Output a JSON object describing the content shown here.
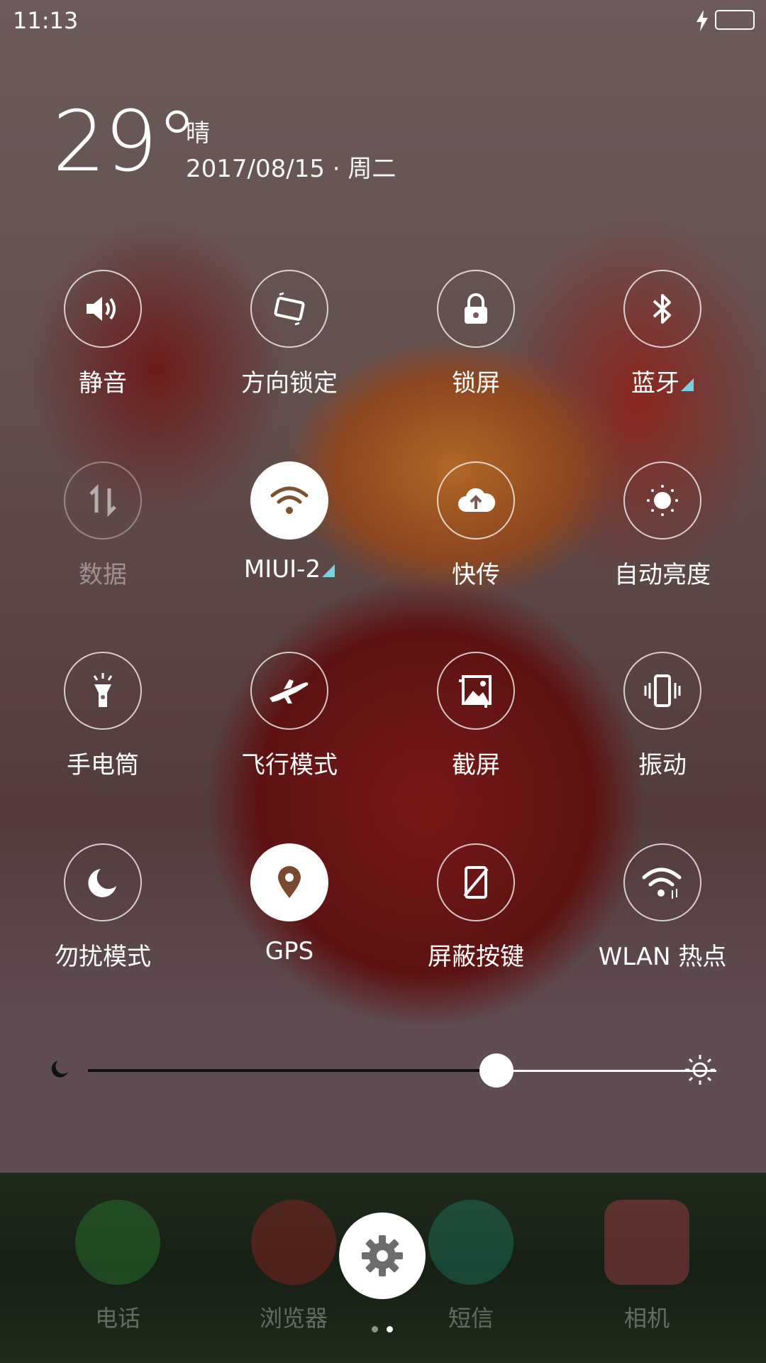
{
  "status_bar": {
    "time": "11:13",
    "battery_color": "#3ed64a",
    "icons": [
      "charging-bolt-icon",
      "battery-icon"
    ]
  },
  "weather": {
    "temperature": "29°",
    "condition": "晴",
    "date": "2017/08/15 · 周二"
  },
  "toggles": [
    {
      "label": "静音",
      "icon": "speaker-icon",
      "state": "normal"
    },
    {
      "label": "方向锁定",
      "icon": "rotation-lock-icon",
      "state": "normal"
    },
    {
      "label": "锁屏",
      "icon": "lock-icon",
      "state": "normal"
    },
    {
      "label": "蓝牙",
      "icon": "bluetooth-icon",
      "state": "normal",
      "expandable": true
    },
    {
      "label": "数据",
      "icon": "mobile-data-icon",
      "state": "disabled"
    },
    {
      "label": "MIUI-2",
      "icon": "wifi-icon",
      "state": "on",
      "expandable": true
    },
    {
      "label": "快传",
      "icon": "cloud-upload-icon",
      "state": "normal"
    },
    {
      "label": "自动亮度",
      "icon": "auto-brightness-icon",
      "state": "normal"
    },
    {
      "label": "手电筒",
      "icon": "flashlight-icon",
      "state": "normal"
    },
    {
      "label": "飞行模式",
      "icon": "airplane-icon",
      "state": "normal"
    },
    {
      "label": "截屏",
      "icon": "screenshot-icon",
      "state": "normal"
    },
    {
      "label": "振动",
      "icon": "vibrate-icon",
      "state": "normal"
    },
    {
      "label": "勿扰模式",
      "icon": "moon-icon",
      "state": "normal"
    },
    {
      "label": "GPS",
      "icon": "location-pin-icon",
      "state": "on"
    },
    {
      "label": "屏蔽按键",
      "icon": "block-keys-icon",
      "state": "normal"
    },
    {
      "label": "WLAN 热点",
      "icon": "hotspot-icon",
      "state": "normal"
    }
  ],
  "brightness": {
    "level": 0.65
  },
  "dock": {
    "apps": [
      {
        "label": "电话",
        "icon": "phone-icon",
        "color": "#2e9e3c"
      },
      {
        "label": "浏览器",
        "icon": "browser-icon",
        "color": "#c8262a"
      },
      {
        "label": "短信",
        "icon": "sms-icon",
        "color": "#1f9a7c"
      },
      {
        "label": "相机",
        "icon": "camera-icon",
        "color": "#e04a5a"
      }
    ],
    "settings_icon": "gear-icon",
    "page_dots": 2,
    "active_page": 1
  }
}
